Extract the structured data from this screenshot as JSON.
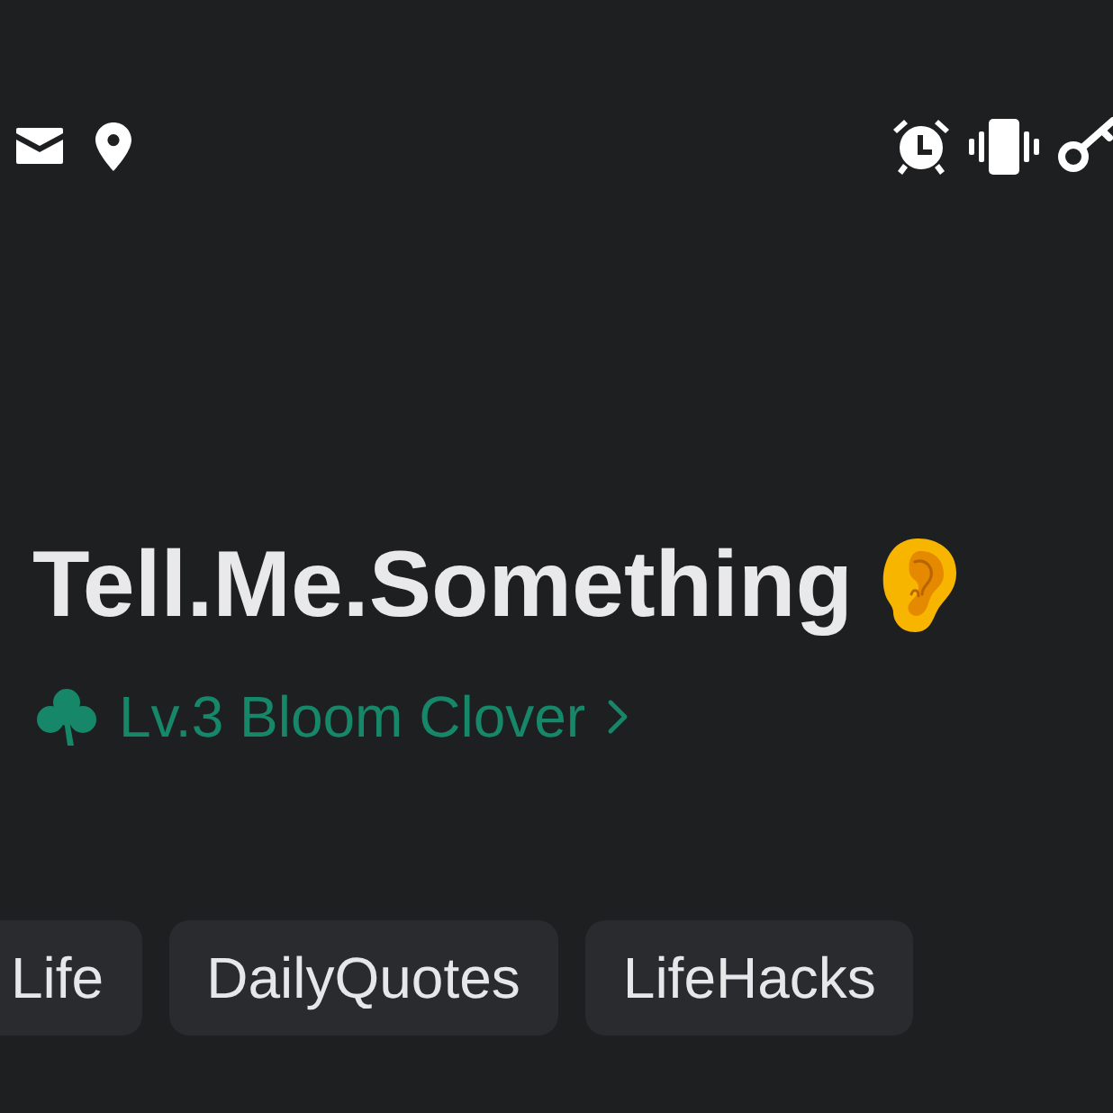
{
  "profile": {
    "name": "Tell.Me.Something",
    "level_link": "Lv.3 Bloom Clover"
  },
  "tags": [
    {
      "label": "Life"
    },
    {
      "label": "DailyQuotes"
    },
    {
      "label": "LifeHacks"
    }
  ]
}
